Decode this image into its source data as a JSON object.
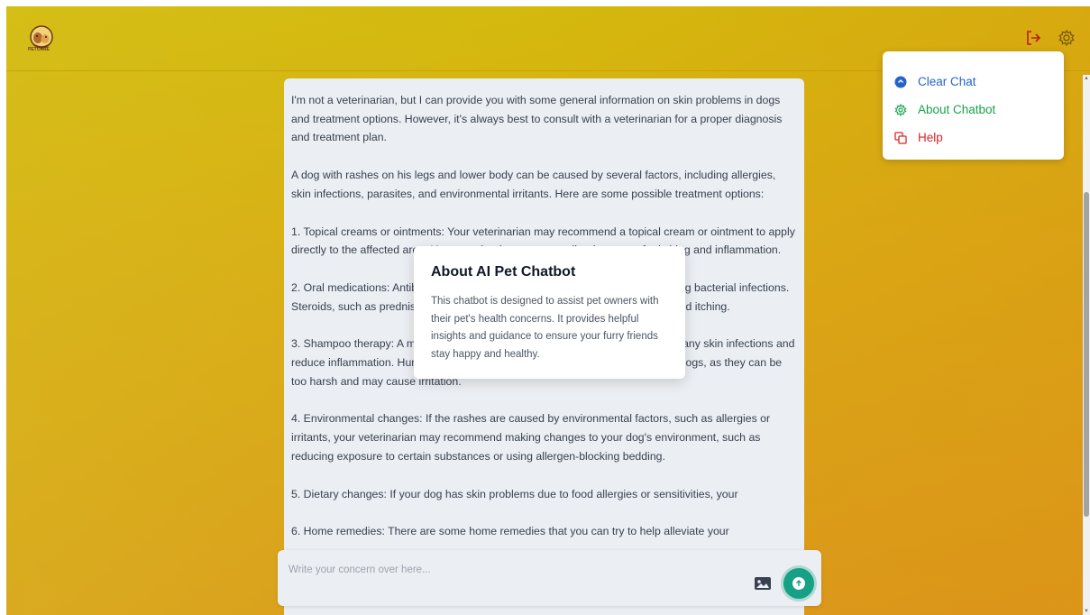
{
  "header": {
    "logo_text": "PETCARE",
    "logout_icon": "logout-icon",
    "settings_icon": "gear-icon"
  },
  "menu": {
    "items": [
      {
        "label": "Clear Chat",
        "icon": "clear-circle-icon",
        "color": "#2563c9"
      },
      {
        "label": "About Chatbot",
        "icon": "gear-icon",
        "color": "#16a34a"
      },
      {
        "label": "Help",
        "icon": "copy-icon",
        "color": "#dc2626"
      }
    ]
  },
  "chat": {
    "paragraphs": [
      "I'm not a veterinarian, but I can provide you with some general information on skin problems in dogs and treatment options. However, it's always best to consult with a veterinarian for a proper diagnosis and treatment plan.",
      "A dog with rashes on his legs and lower body can be caused by several factors, including allergies, skin infections, parasites, and environmental irritants. Here are some possible treatment options:",
      "1. Topical creams or ointments: Your veterinarian may recommend a topical cream or ointment to apply directly to the affected area. Your veterinarian may prescribe the cream for itching and inflammation.",
      "2. Oral medications: Antibiotics may be prescribed to help clear up any underlying bacterial infections. Steroids, such as prednisone, may also be prescribed to reduce inflammation and itching.",
      "3. Shampoo therapy: A medicated shampoo may be prescribed to help clear up any skin infections and reduce inflammation. Human shampoo or conditioner should never be used on dogs, as they can be too harsh and may cause irritation.",
      "4. Environmental changes: If the rashes are caused by environmental factors, such as allergies or irritants, your veterinarian may recommend making changes to your dog's environment, such as reducing exposure to certain substances or using allergen-blocking bedding.",
      "5. Dietary changes: If your dog has skin problems due to food allergies or sensitivities, your",
      "6. Home remedies: There are some home remedies that you can try to help alleviate your"
    ]
  },
  "modal": {
    "title": "About AI Pet Chatbot",
    "body": "This chatbot is designed to assist pet owners with their pet's health concerns. It provides helpful insights and guidance to ensure your furry friends stay happy and healthy."
  },
  "input": {
    "placeholder": "Write your concern over here...",
    "image_icon": "image-icon",
    "send_icon": "send-icon"
  },
  "colors": {
    "accent_send": "#16a085",
    "background_top": "#d4b90d",
    "background_bottom": "#db9a1b"
  }
}
